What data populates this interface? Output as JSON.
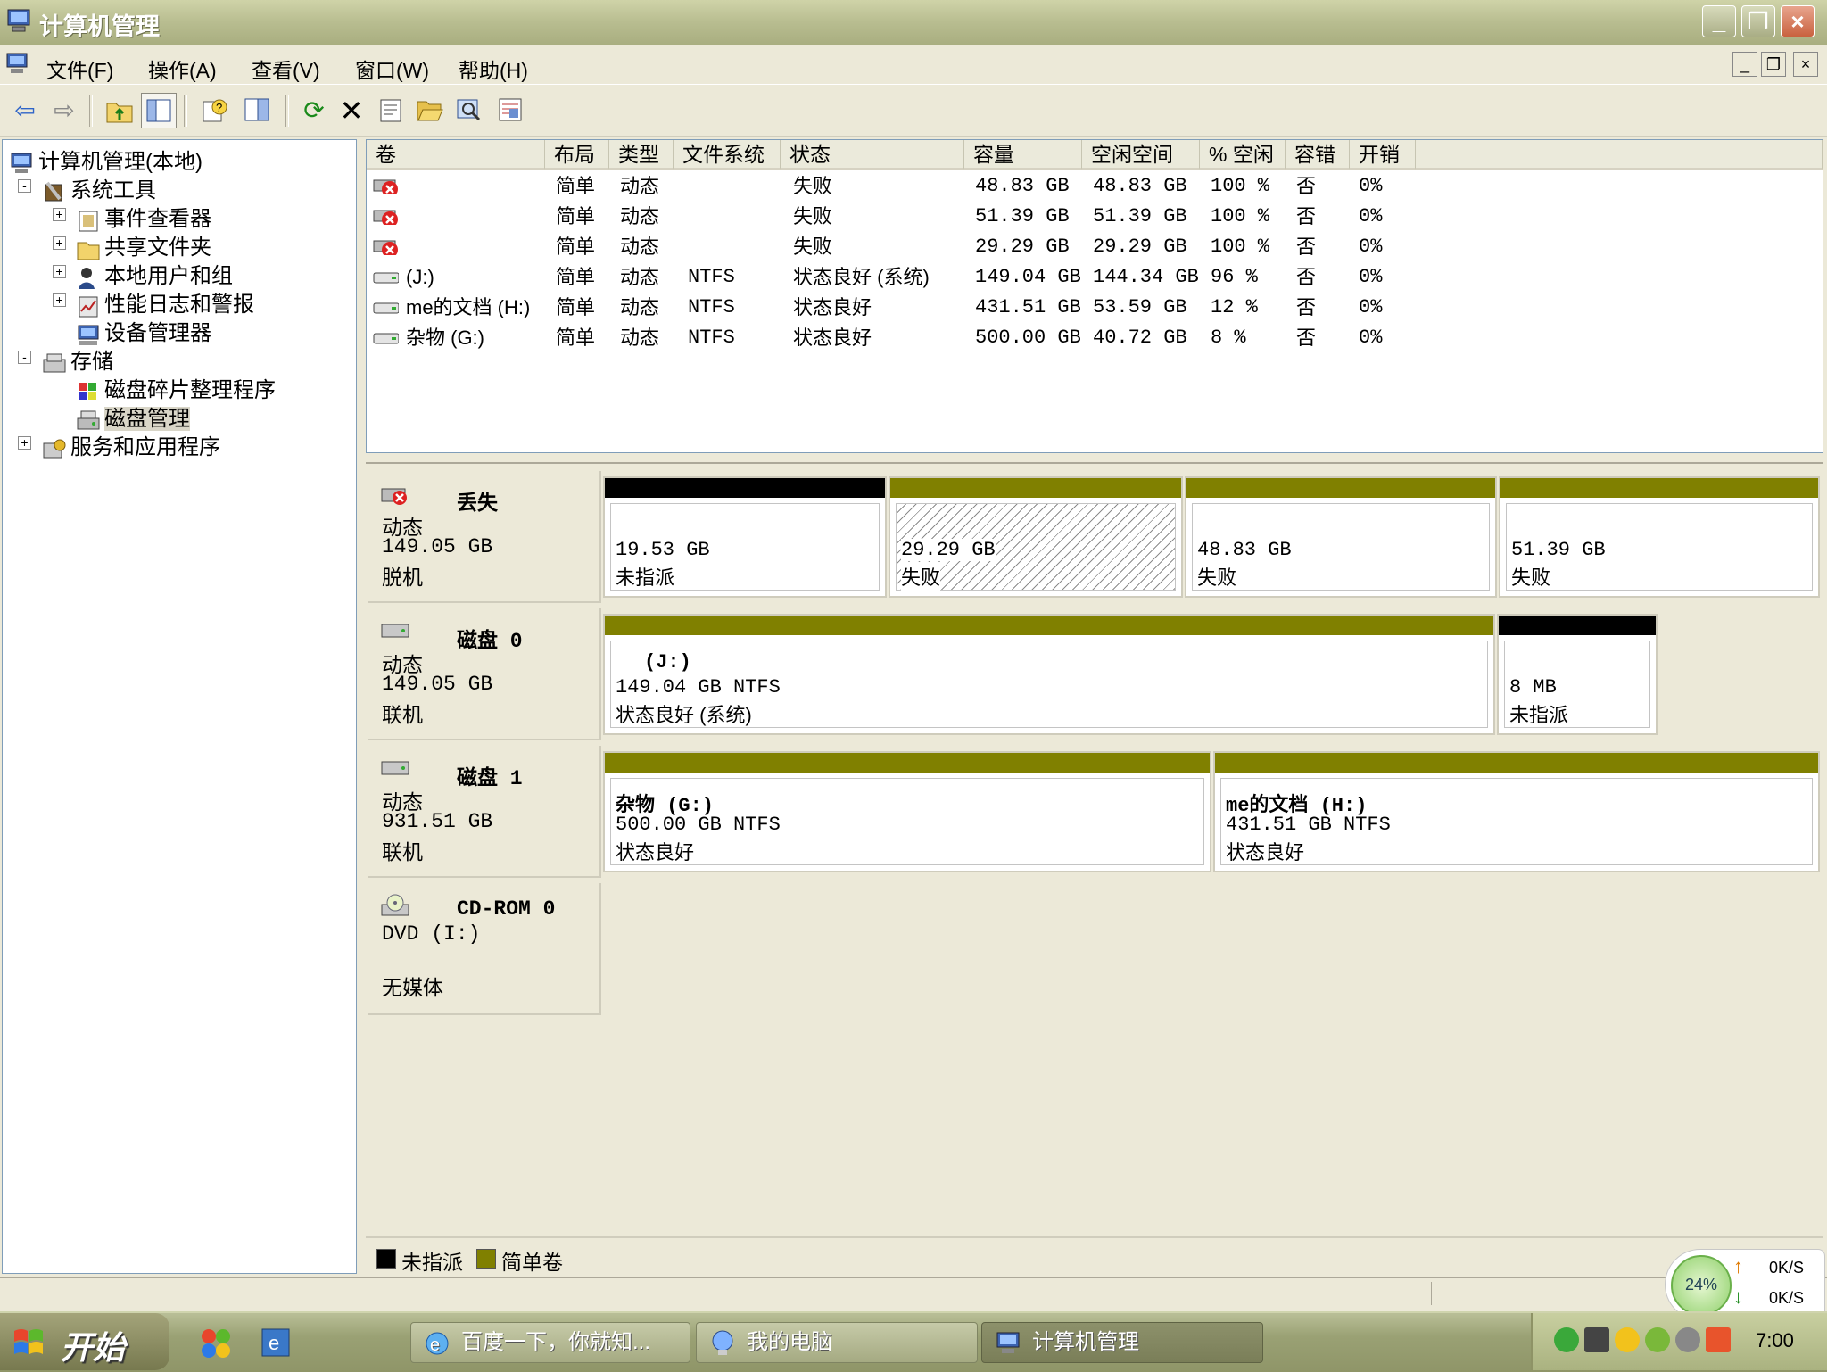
{
  "window": {
    "title": "计算机管理",
    "controls": {
      "minimize": "_",
      "maximize": "❐",
      "close": "×"
    }
  },
  "menu": {
    "items": [
      "文件(F)",
      "操作(A)",
      "查看(V)",
      "窗口(W)",
      "帮助(H)"
    ],
    "mdi": {
      "minimize": "_",
      "restore": "❐",
      "close": "×"
    }
  },
  "tree": {
    "root": "计算机管理(本地)",
    "system_tools": "系统工具",
    "event_viewer": "事件查看器",
    "shared_folders": "共享文件夹",
    "local_users": "本地用户和组",
    "perf_logs": "性能日志和警报",
    "device_manager": "设备管理器",
    "storage": "存储",
    "defrag": "磁盘碎片整理程序",
    "disk_mgmt": "磁盘管理",
    "services_apps": "服务和应用程序",
    "expander_plus": "+",
    "expander_minus": "-"
  },
  "volumes": {
    "columns": [
      "卷",
      "布局",
      "类型",
      "文件系统",
      "状态",
      "容量",
      "空闲空间",
      "% 空闲",
      "容错",
      "开销"
    ],
    "rows": [
      {
        "volume": "",
        "layout": "简单",
        "type": "动态",
        "fs": "",
        "status": "失败",
        "capacity": "48.83 GB",
        "free": "48.83 GB",
        "pct_free": "100 %",
        "fault": "否",
        "overhead": "0%",
        "icon": "failed-volume-icon"
      },
      {
        "volume": "",
        "layout": "简单",
        "type": "动态",
        "fs": "",
        "status": "失败",
        "capacity": "51.39 GB",
        "free": "51.39 GB",
        "pct_free": "100 %",
        "fault": "否",
        "overhead": "0%",
        "icon": "failed-volume-icon"
      },
      {
        "volume": "",
        "layout": "简单",
        "type": "动态",
        "fs": "",
        "status": "失败",
        "capacity": "29.29 GB",
        "free": "29.29 GB",
        "pct_free": "100 %",
        "fault": "否",
        "overhead": "0%",
        "icon": "failed-volume-icon"
      },
      {
        "volume": "(J:)",
        "layout": "简单",
        "type": "动态",
        "fs": "NTFS",
        "status": "状态良好 (系统)",
        "capacity": "149.04 GB",
        "free": "144.34 GB",
        "pct_free": "96 %",
        "fault": "否",
        "overhead": "0%",
        "icon": "drive-icon"
      },
      {
        "volume": "me的文档 (H:)",
        "layout": "简单",
        "type": "动态",
        "fs": "NTFS",
        "status": "状态良好",
        "capacity": "431.51 GB",
        "free": "53.59 GB",
        "pct_free": "12 %",
        "fault": "否",
        "overhead": "0%",
        "icon": "drive-icon"
      },
      {
        "volume": "杂物 (G:)",
        "layout": "简单",
        "type": "动态",
        "fs": "NTFS",
        "status": "状态良好",
        "capacity": "500.00 GB",
        "free": "40.72 GB",
        "pct_free": "8 %",
        "fault": "否",
        "overhead": "0%",
        "icon": "drive-icon"
      }
    ]
  },
  "disks": {
    "missing": {
      "name": "丢失",
      "kind": "动态",
      "size": "149.05 GB",
      "state": "脱机",
      "parts": [
        {
          "size": "19.53 GB",
          "status": "未指派"
        },
        {
          "size": "29.29 GB",
          "status": "失败"
        },
        {
          "size": "48.83 GB",
          "status": "失败"
        },
        {
          "size": "51.39 GB",
          "status": "失败"
        }
      ]
    },
    "disk0": {
      "name": "磁盘 0",
      "kind": "动态",
      "size": "149.05 GB",
      "state": "联机",
      "parts": [
        {
          "label": "(J:)",
          "size": "149.04 GB NTFS",
          "status": "状态良好 (系统)"
        },
        {
          "size": "8 MB",
          "status": "未指派"
        }
      ]
    },
    "disk1": {
      "name": "磁盘 1",
      "kind": "动态",
      "size": "931.51 GB",
      "state": "联机",
      "parts": [
        {
          "label": "杂物 (G:)",
          "size": "500.00 GB NTFS",
          "status": "状态良好"
        },
        {
          "label": "me的文档 (H:)",
          "size": "431.51 GB NTFS",
          "status": "状态良好"
        }
      ]
    },
    "cdrom": {
      "name": "CD-ROM 0",
      "kind": "DVD (I:)",
      "state": "无媒体"
    }
  },
  "legend": {
    "unallocated": "未指派",
    "simple": "简单卷"
  },
  "colors": {
    "unallocated": "#000000",
    "simple": "#808000",
    "tree_border": "#7f9db9"
  },
  "net": {
    "percent": "24%",
    "up_rate": "0K/S",
    "down_rate": "0K/S",
    "up_arrow": "↑",
    "down_arrow": "↓"
  },
  "taskbar": {
    "start": "开始",
    "tasks": [
      "百度一下，你就知...",
      "我的电脑",
      "计算机管理"
    ],
    "clock": "7:00"
  }
}
